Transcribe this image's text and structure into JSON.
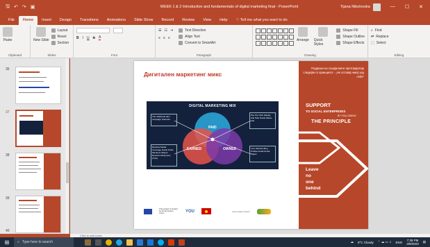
{
  "window": {
    "title": "WEEK 1 & 2 Introduction and fundamentals of digital marketing final - PowerPoint",
    "user": "Tijana Nikolovska",
    "min": "—",
    "max": "☐",
    "close": "✕"
  },
  "tabs": [
    "File",
    "Home",
    "Insert",
    "Design",
    "Transitions",
    "Animations",
    "Slide Show",
    "Record",
    "Review",
    "View",
    "Help"
  ],
  "tellme": "Tell me what you want to do",
  "ribbon": {
    "paste": "Paste",
    "clipboard": "Clipboard",
    "new_slide": "New Slide",
    "layout": "Layout",
    "reset": "Reset",
    "section": "Section",
    "slides": "Slides",
    "font": "Font",
    "paragraph": "Paragraph",
    "text_direction": "Text Direction",
    "align_text": "Align Text",
    "convert_smartart": "Convert to SmartArt",
    "arrange": "Arrange",
    "quick_styles": "Quick Styles",
    "shape_fill": "Shape Fill",
    "shape_outline": "Shape Outline",
    "shape_effects": "Shape Effects",
    "drawing": "Drawing",
    "find": "Find",
    "replace": "Replace",
    "select": "Select",
    "editing": "Editing"
  },
  "slides_panel": {
    "numbers": [
      "36",
      "37",
      "38",
      "39",
      "40"
    ],
    "current": "37"
  },
  "slide": {
    "title": "Дигитален маркетинг микс",
    "dm_title": "DIGITAL MARKETING MIX",
    "paid": "PAID",
    "earned": "EARNED",
    "owned": "OWNED",
    "box_tl": "The traditional ads / campaign channels",
    "box_tr": "Pay Per Click Display Ads Paid Social Native Ads",
    "box_bl": "Reviews Media Coverage Social Posts Mentions Shares Reposts Influencers (Free)",
    "box_br": "Your Website Blog Profiles Email Social Pages",
    "quote": "Подршка на социјалните претпријатија следејќи го принципот - „Не оставај никој зад себе“",
    "support": "SUPPORT",
    "social": "TO SOCIAL ENTERPRISES",
    "following": "BY FOLLOWING",
    "principle": "THE PRINCIPLE",
    "leave1": "Leave",
    "leave2": "no",
    "leave3": "one",
    "leave4": "behind",
    "eu_text": "This project is funded by the European Union",
    "you": "YOU",
    "logo3": "Lorem ipsum lorem"
  },
  "notes": "Click to add notes",
  "taskbar": {
    "search": "Type here to search",
    "weather": "9°C Cloudy",
    "lang": "ENG",
    "time": "7:39 PM",
    "date": "3/9/2023"
  }
}
